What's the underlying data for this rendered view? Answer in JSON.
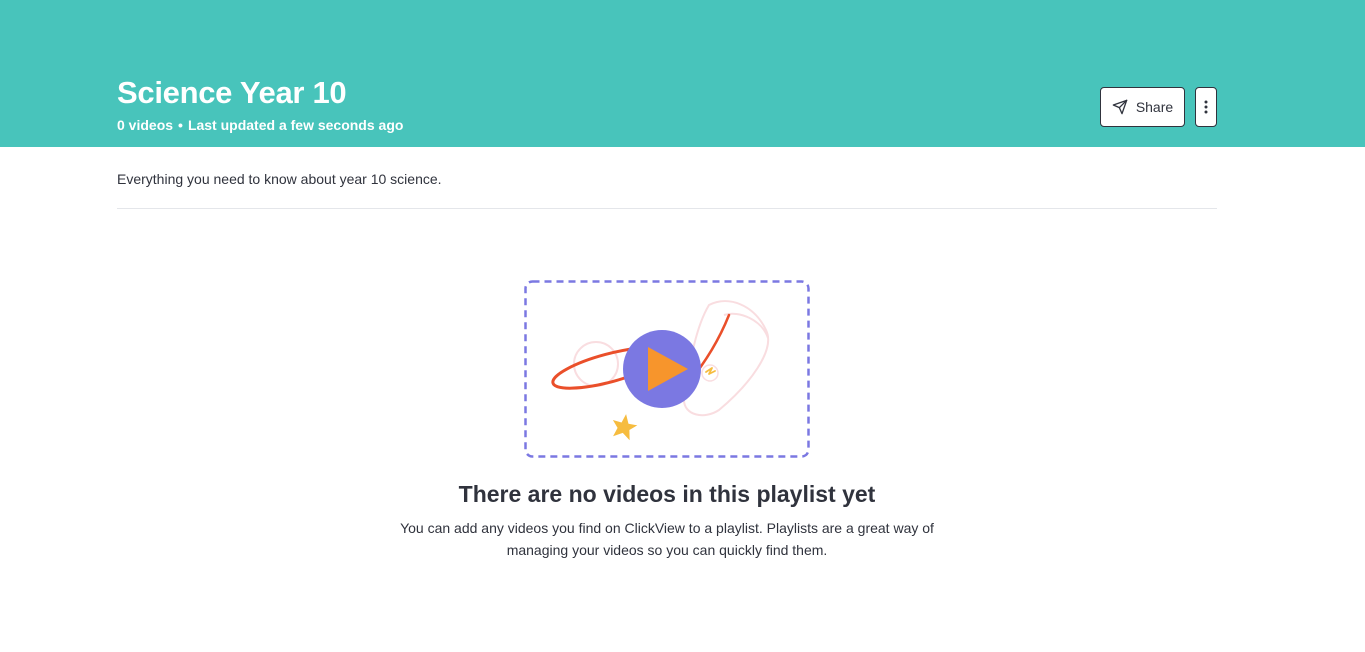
{
  "header": {
    "title": "Science Year 10",
    "video_count": "0 videos",
    "separator": "•",
    "last_updated": "Last updated a few seconds ago",
    "background_color": "#48c4bb"
  },
  "actions": {
    "share_label": "Share",
    "share_icon": "send-icon",
    "more_icon": "more-vertical-icon"
  },
  "description": "Everything you need to know about year 10 science.",
  "empty_state": {
    "illustration": "video-playlist-placeholder",
    "title": "There are no videos in this playlist yet",
    "message": "You can add any videos you find on ClickView to a playlist. Playlists are a great way of managing your videos so you can quickly find them.",
    "accent_color": "#7b78e2",
    "play_color": "#f7952c"
  }
}
